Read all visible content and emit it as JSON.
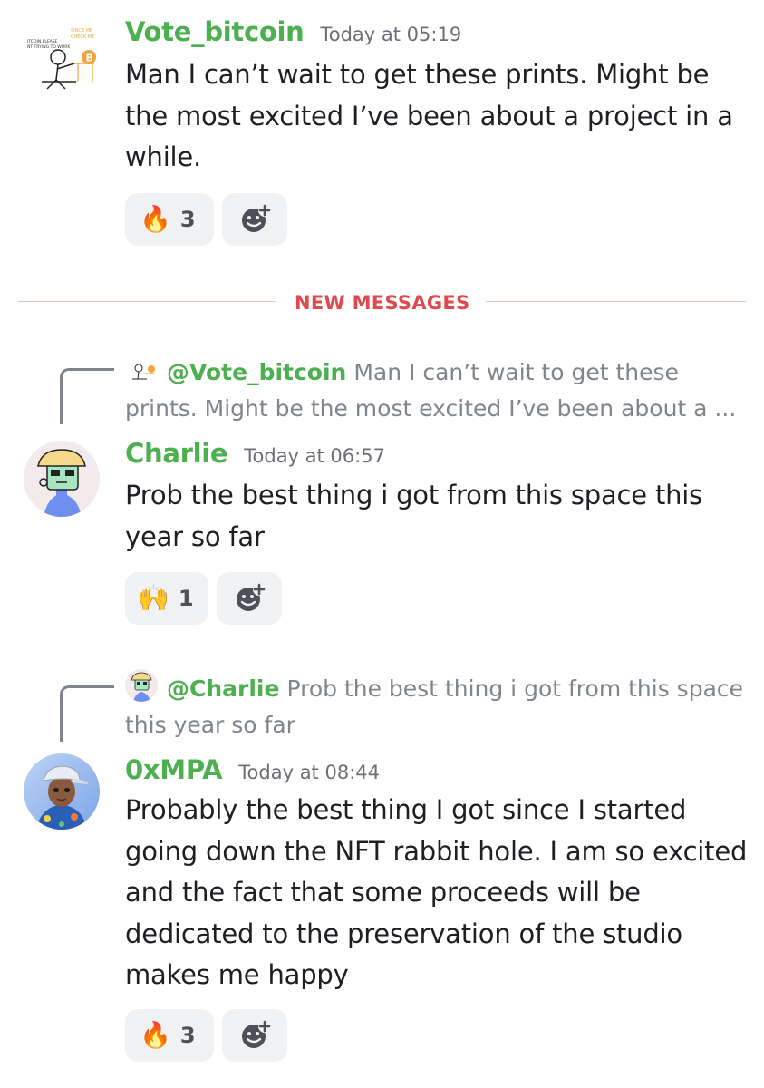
{
  "messages": [
    {
      "username": "Vote_bitcoin",
      "timestamp": "Today at 05:19",
      "text": "Man I can’t wait to get these prints. Might be the most excited I’ve been about a project in a while.",
      "avatar_icon": "stick-figure-bitcoin-avatar",
      "avatar_text": [
        "SINCE ME",
        "CHECK ME",
        "ITCOIN PLEASE",
        "NT TRYING TO WORK"
      ],
      "reactions": [
        {
          "emoji": "🔥",
          "count": "3"
        }
      ]
    },
    {
      "username": "Charlie",
      "timestamp": "Today at 06:57",
      "text": "Prob the best thing i got from this space this year so far",
      "avatar_icon": "bucket-hat-character-avatar",
      "reply": {
        "mention": "@Vote_bitcoin",
        "text": "Man I can’t wait to get these prints. Might be the most excited I’ve been about a ..."
      },
      "reactions": [
        {
          "emoji": "🙌",
          "count": "1"
        }
      ]
    },
    {
      "username": "0xMPA",
      "timestamp": "Today at 08:44",
      "text": "Probably the best thing I got since I started going down the NFT rabbit hole. I am so excited and the fact that some proceeds will be dedicated to the preservation of the studio makes me happy",
      "avatar_icon": "cap-character-avatar",
      "reply": {
        "mention": "@Charlie",
        "text": "Prob the best thing i got from this space this year so far"
      },
      "reactions": [
        {
          "emoji": "🔥",
          "count": "3"
        }
      ]
    }
  ],
  "divider": {
    "label": "NEW MESSAGES"
  },
  "icons": {
    "add_reaction": "add-reaction-icon"
  },
  "colors": {
    "username": "#4caf50",
    "divider": "#e04a4f",
    "muted": "#80848e",
    "reaction_bg": "#f0f1f3"
  }
}
